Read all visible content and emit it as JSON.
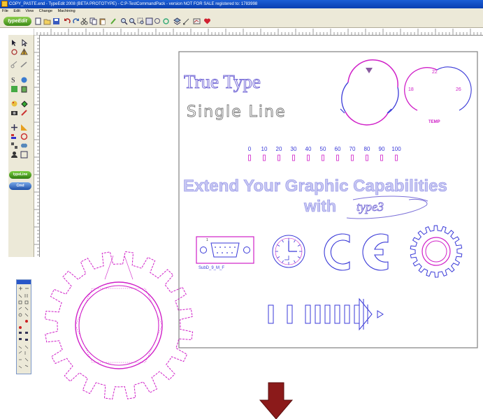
{
  "window": {
    "title": "COPY_PASTE.end - TypeEdit 2008 (BETA PROTOTYPE) - C:P-TestCommandPack - version NOT FOR SALE registered to: 1783998"
  },
  "menu": [
    "File",
    "Edit",
    "View",
    "Change",
    "Machining"
  ],
  "toolbar": {
    "logo": "typeEdit"
  },
  "left_toolbar": {
    "pill1": "typeLine",
    "pill2": "Cmd"
  },
  "drawing": {
    "true_type": "True Type",
    "single_line": "Single Line",
    "scale_numbers": [
      "0",
      "10",
      "20",
      "30",
      "40",
      "50",
      "60",
      "70",
      "80",
      "90",
      "100"
    ],
    "dial_22": "22",
    "dial_18": "18",
    "dial_26": "26",
    "temp": "TEMP",
    "extend_line1": "Extend Your Graphic Capabilities",
    "extend_line2": "with",
    "logo_text": "type3",
    "connector_pin": "1",
    "connector_label": "SubD_9_M_F",
    "ce_mark": "CE"
  },
  "colors": {
    "magenta": "#d020c8",
    "blue_outline": "#3a3ad8",
    "grey_text": "#777777",
    "lavender": "#9a9aee",
    "arrow": "#8b1a1a"
  },
  "icons": [
    "gear-icon",
    "clock-icon",
    "down-arrow-icon",
    "progress-bar-icon",
    "connector-icon"
  ]
}
